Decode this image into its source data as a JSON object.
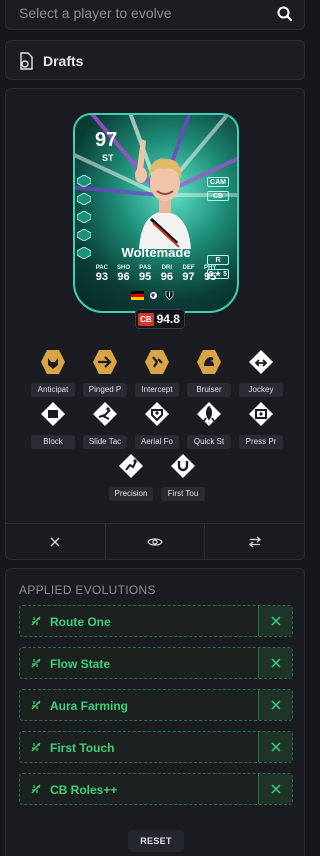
{
  "search": {
    "placeholder": "Select a player to evolve"
  },
  "drafts": {
    "label": "Drafts"
  },
  "card": {
    "rating": "97",
    "position": "ST",
    "alt_positions": [
      "CAM",
      "CB"
    ],
    "extra_badges": [
      "R",
      "5 ★ 5"
    ],
    "name": "Woltemade",
    "stats": [
      {
        "key": "PAC",
        "value": "93"
      },
      {
        "key": "SHO",
        "value": "96"
      },
      {
        "key": "PAS",
        "value": "95"
      },
      {
        "key": "DRI",
        "value": "96"
      },
      {
        "key": "DEF",
        "value": "97"
      },
      {
        "key": "PHY",
        "value": "95"
      }
    ],
    "ovr_position": "CB",
    "ovr_value": "94.8"
  },
  "traits": [
    {
      "label": "Anticipat",
      "style": "gold",
      "icon": "anticipate-icon"
    },
    {
      "label": "Pinged P",
      "style": "gold",
      "icon": "pinged-pass-icon"
    },
    {
      "label": "Intercept",
      "style": "gold",
      "icon": "intercept-icon"
    },
    {
      "label": "Bruiser",
      "style": "gold",
      "icon": "bruiser-icon"
    },
    {
      "label": "Jockey",
      "style": "white",
      "icon": "jockey-icon"
    },
    {
      "label": "Block",
      "style": "white",
      "icon": "block-icon"
    },
    {
      "label": "Slide Tac",
      "style": "white",
      "icon": "slide-tackle-icon"
    },
    {
      "label": "Aerial Fo",
      "style": "white",
      "icon": "aerial-fortress-icon"
    },
    {
      "label": "Quick St",
      "style": "white",
      "icon": "quick-step-icon"
    },
    {
      "label": "Press Pr",
      "style": "white",
      "icon": "press-proven-icon"
    },
    {
      "label": "Precision",
      "style": "white",
      "icon": "precision-icon"
    },
    {
      "label": "First Tou",
      "style": "white",
      "icon": "first-touch-icon"
    }
  ],
  "actions": [
    "close-icon",
    "eye-icon",
    "swap-icon"
  ],
  "applied": {
    "title": "APPLIED EVOLUTIONS",
    "items": [
      {
        "name": "Route One"
      },
      {
        "name": "Flow State"
      },
      {
        "name": "Aura Farming"
      },
      {
        "name": "First Touch"
      },
      {
        "name": "CB Roles++"
      }
    ]
  },
  "reset_label": "RESET",
  "colors": {
    "accent_green": "#3fd07a",
    "gold": "#d9a446",
    "card_teal": "#3fd1b5",
    "red": "#d23a2d"
  }
}
